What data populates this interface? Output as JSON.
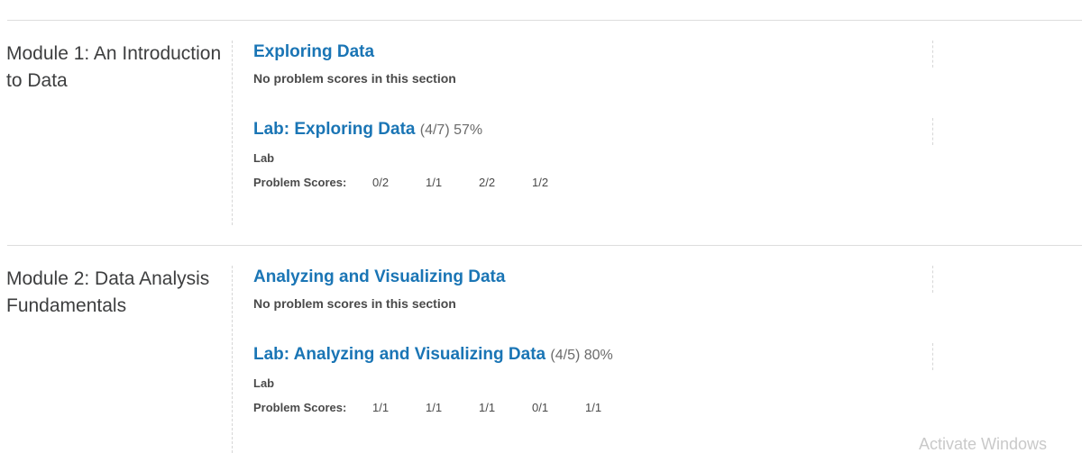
{
  "modules": [
    {
      "title": "Module 1: An Introduction to Data",
      "sections": [
        {
          "title": "Exploring Data",
          "no_scores_text": "No problem scores in this section"
        },
        {
          "title": "Lab: Exploring Data",
          "score_info": "(4/7) 57%",
          "subtitle": "Lab",
          "scores_label": "Problem Scores:",
          "scores": [
            "0/2",
            "1/1",
            "2/2",
            "1/2"
          ]
        }
      ]
    },
    {
      "title": "Module 2: Data Analysis Fundamentals",
      "sections": [
        {
          "title": "Analyzing and Visualizing Data",
          "no_scores_text": "No problem scores in this section"
        },
        {
          "title": "Lab: Analyzing and Visualizing Data",
          "score_info": "(4/5) 80%",
          "subtitle": "Lab",
          "scores_label": "Problem Scores:",
          "scores": [
            "1/1",
            "1/1",
            "1/1",
            "0/1",
            "1/1"
          ]
        }
      ]
    }
  ],
  "watermark": "Activate Windows"
}
